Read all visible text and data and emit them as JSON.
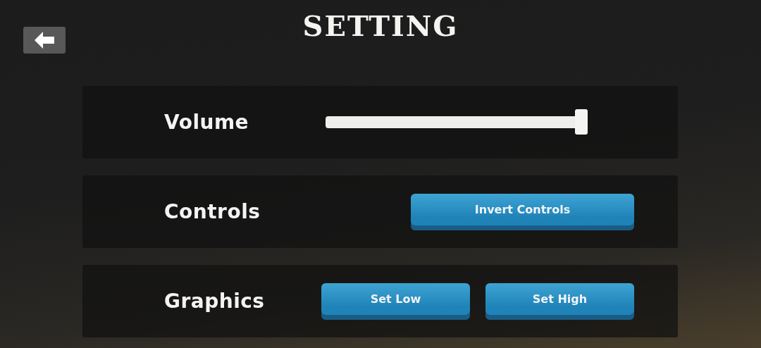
{
  "title": "SETTING",
  "rows": [
    {
      "kind": "slider",
      "label": "Volume",
      "level": 1
    },
    {
      "kind": "buttons",
      "label": "Controls",
      "buttons": [
        "Invert Controls"
      ]
    },
    {
      "kind": "buttons",
      "label": "Graphics",
      "buttons": [
        "Set Low",
        "Set High"
      ]
    }
  ]
}
